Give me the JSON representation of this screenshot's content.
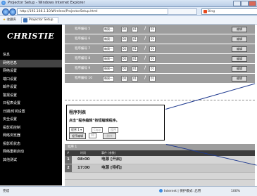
{
  "browser": {
    "title": "Projector Setup - Windows Internet Explorer",
    "url": "http://192.168.1.10/Wireless/ProjectorSetup.html",
    "search_placeholder": "Bing",
    "tab_label": "Projector Setup",
    "favorites_label": "收藏夹"
  },
  "brand": {
    "logo": "CHRISTIE"
  },
  "sidebar": {
    "items": [
      {
        "label": "信息",
        "active": false
      },
      {
        "label": "网络信息",
        "active": true
      },
      {
        "label": "网络设置",
        "active": false
      },
      {
        "label": "端口设置",
        "active": false
      },
      {
        "label": "邮件设置",
        "active": false
      },
      {
        "label": "警报设置",
        "active": false
      },
      {
        "label": "日程表设置",
        "active": false
      },
      {
        "label": "日期/时间设置",
        "active": false
      },
      {
        "label": "安全设置",
        "active": false
      },
      {
        "label": "投影机控制",
        "active": false
      },
      {
        "label": "网络浏览器",
        "active": false
      },
      {
        "label": "投影机状态",
        "active": false
      },
      {
        "label": "网络重新启动",
        "active": false
      },
      {
        "label": "其他测试",
        "active": false
      }
    ]
  },
  "program_rows": [
    {
      "label": "程序编号 5",
      "mode": "每周一",
      "hour": "00",
      "min": "01",
      "button": "编辑"
    },
    {
      "label": "程序编号 6",
      "mode": "每周一",
      "hour": "00",
      "min": "01",
      "button": "编辑"
    },
    {
      "label": "程序编号 7",
      "mode": "每周一",
      "hour": "00",
      "min": "01",
      "button": "编辑"
    },
    {
      "label": "程序编号 8",
      "mode": "每周一",
      "hour": "00",
      "min": "01",
      "button": "编辑"
    },
    {
      "label": "程序编号 9",
      "mode": "每周一",
      "hour": "00",
      "min": "01",
      "button": "编辑"
    },
    {
      "label": "程序编号 10",
      "mode": "每周一",
      "hour": "00",
      "min": "01",
      "button": "编辑"
    }
  ],
  "program_list": {
    "title": "程序列表",
    "hint": "点击“程序编辑”按钮编辑程序。",
    "select_value": "程序 1",
    "copy_label": "Copy",
    "copy_to": "程序",
    "edit_button": "程序编辑",
    "no_label": "00",
    "delete_label": "(删除)"
  },
  "schedule_table": {
    "header": "程序 1",
    "col_no": "#",
    "col_time": "时间",
    "col_event": "事件 (参数)",
    "rows": [
      {
        "no": "1",
        "time": "08:00",
        "event": "电源 [开启]"
      },
      {
        "no": "2",
        "time": "17:00",
        "event": "电源 [待机]"
      }
    ]
  },
  "statusbar": {
    "left": "完成",
    "zone": "Internet | 保护模式: 启用",
    "zoom": "100%"
  }
}
